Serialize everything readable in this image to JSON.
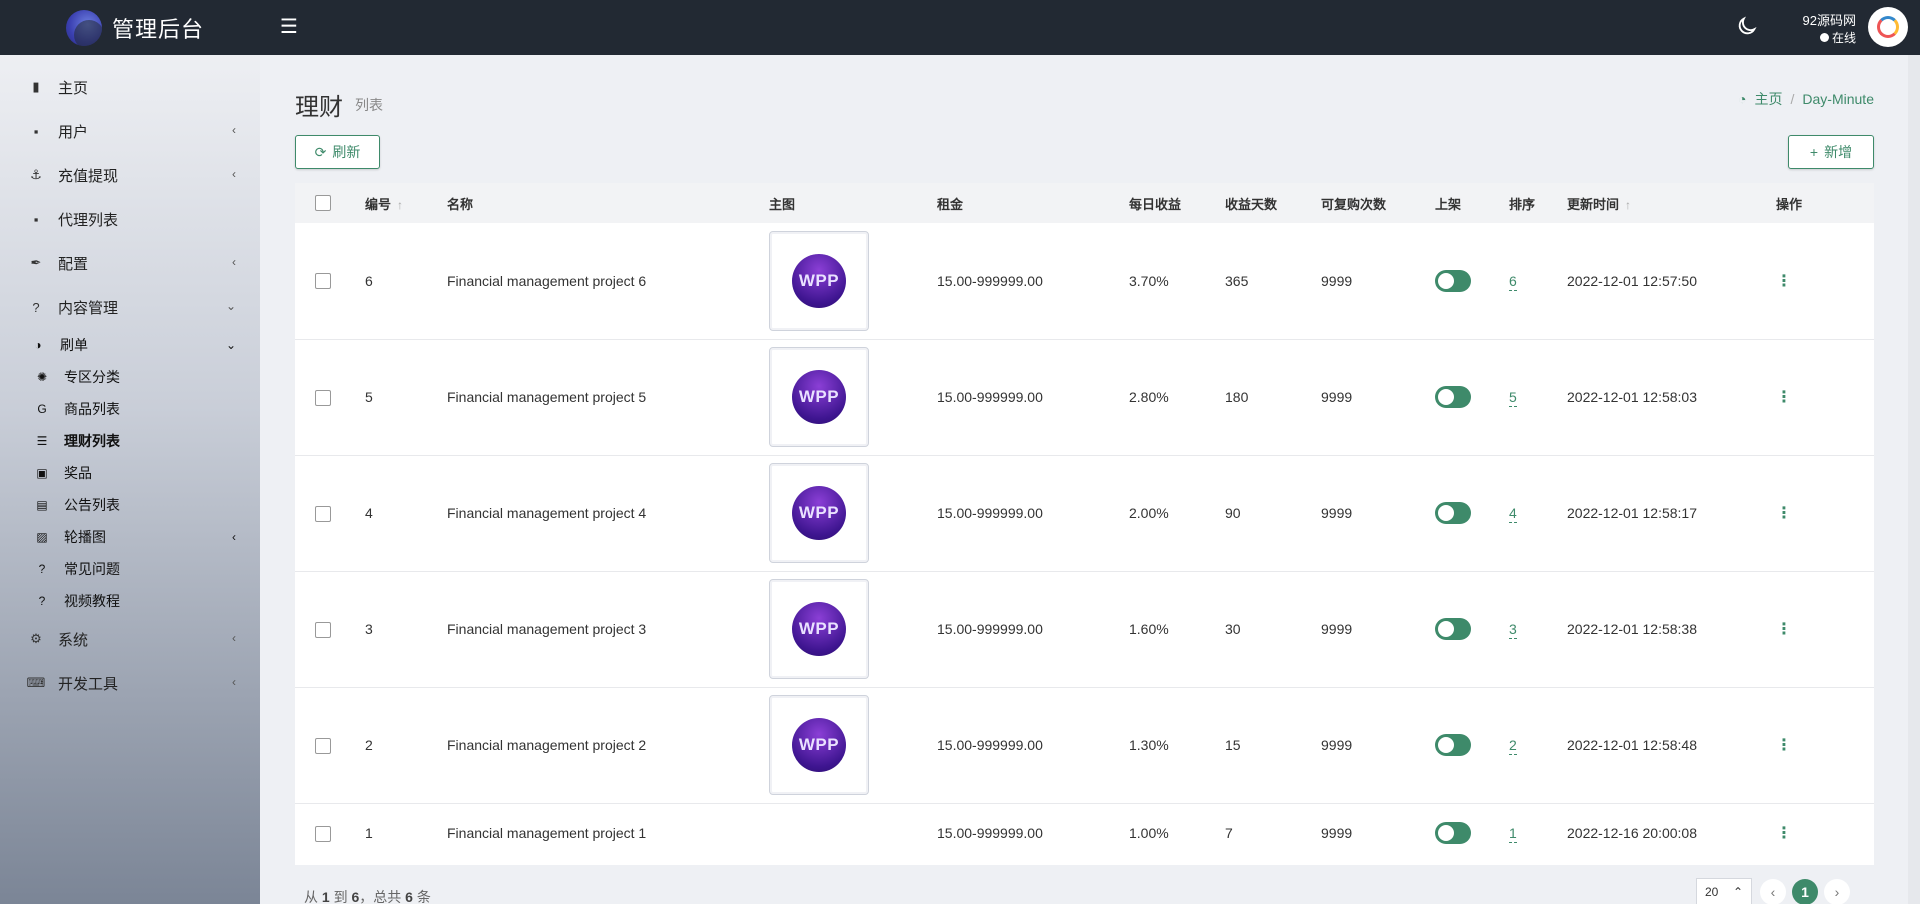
{
  "app": {
    "title": "管理后台"
  },
  "sidebar": {
    "items": [
      {
        "label": "主页",
        "icon": "bar-chart-icon",
        "glyph": "▮",
        "has_chevron": false
      },
      {
        "label": "用户",
        "icon": "user-card-icon",
        "glyph": "▪",
        "has_chevron": true,
        "chevron": "‹"
      },
      {
        "label": "充值提现",
        "icon": "anchor-icon",
        "glyph": "⚓",
        "has_chevron": true,
        "chevron": "‹"
      },
      {
        "label": "代理列表",
        "icon": "user-card-icon",
        "glyph": "▪",
        "has_chevron": false
      },
      {
        "label": "配置",
        "icon": "magic-icon",
        "glyph": "✒",
        "has_chevron": true,
        "chevron": "‹"
      },
      {
        "label": "内容管理",
        "icon": "question-circle-icon",
        "glyph": "?",
        "has_chevron": true,
        "chevron": "⌄"
      }
    ],
    "content_sub": [
      {
        "label": "刷单",
        "icon": "adjust-icon",
        "glyph": "◑",
        "chevron": "⌄"
      },
      {
        "label": "专区分类",
        "icon": "gear-icon",
        "glyph": "✺"
      },
      {
        "label": "商品列表",
        "icon": "google-icon",
        "glyph": "G"
      },
      {
        "label": "理财列表",
        "icon": "list-icon",
        "glyph": "☰"
      },
      {
        "label": "奖品",
        "icon": "money-icon",
        "glyph": "▣"
      },
      {
        "label": "公告列表",
        "icon": "file-icon",
        "glyph": "▤"
      },
      {
        "label": "轮播图",
        "icon": "image-icon",
        "glyph": "▨",
        "chevron": "‹"
      },
      {
        "label": "常见问题",
        "icon": "question-icon",
        "glyph": "?"
      },
      {
        "label": "视频教程",
        "icon": "question-icon",
        "glyph": "?"
      }
    ],
    "bottom_items": [
      {
        "label": "系统",
        "icon": "gear-icon",
        "glyph": "⚙",
        "chevron": "‹"
      },
      {
        "label": "开发工具",
        "icon": "keyboard-icon",
        "glyph": "⌨",
        "chevron": "‹"
      }
    ]
  },
  "topbar": {
    "user_name": "92源码网",
    "user_status": "在线"
  },
  "page": {
    "title": "理财",
    "subtitle": "列表",
    "breadcrumb_home": "主页",
    "breadcrumb_current": "Day-Minute",
    "refresh_label": "刷新",
    "add_label": "新增"
  },
  "table": {
    "headers": {
      "id": "编号",
      "name": "名称",
      "image": "主图",
      "rent": "租金",
      "daily": "每日收益",
      "days": "收益天数",
      "repurchase": "可复购次数",
      "listed": "上架",
      "sort": "排序",
      "updated": "更新时间",
      "ops": "操作"
    },
    "rows": [
      {
        "id": "6",
        "name": "Financial management project 6",
        "image": "WPP",
        "rent": "15.00-999999.00",
        "daily": "3.70%",
        "days": "365",
        "repurchase": "9999",
        "listed": true,
        "sort": "6",
        "updated": "2022-12-01 12:57:50"
      },
      {
        "id": "5",
        "name": "Financial management project 5",
        "image": "WPP",
        "rent": "15.00-999999.00",
        "daily": "2.80%",
        "days": "180",
        "repurchase": "9999",
        "listed": true,
        "sort": "5",
        "updated": "2022-12-01 12:58:03"
      },
      {
        "id": "4",
        "name": "Financial management project 4",
        "image": "WPP",
        "rent": "15.00-999999.00",
        "daily": "2.00%",
        "days": "90",
        "repurchase": "9999",
        "listed": true,
        "sort": "4",
        "updated": "2022-12-01 12:58:17"
      },
      {
        "id": "3",
        "name": "Financial management project 3",
        "image": "WPP",
        "rent": "15.00-999999.00",
        "daily": "1.60%",
        "days": "30",
        "repurchase": "9999",
        "listed": true,
        "sort": "3",
        "updated": "2022-12-01 12:58:38"
      },
      {
        "id": "2",
        "name": "Financial management project 2",
        "image": "WPP",
        "rent": "15.00-999999.00",
        "daily": "1.30%",
        "days": "15",
        "repurchase": "9999",
        "listed": true,
        "sort": "2",
        "updated": "2022-12-01 12:58:48"
      },
      {
        "id": "1",
        "name": "Financial management project 1",
        "image": "",
        "rent": "15.00-999999.00",
        "daily": "1.00%",
        "days": "7",
        "repurchase": "9999",
        "listed": true,
        "sort": "1",
        "updated": "2022-12-16 20:00:08"
      }
    ]
  },
  "footer": {
    "from_label": "从",
    "from": "1",
    "to_label": "到",
    "to": "6",
    "total_label": "，总共",
    "total": "6",
    "unit": "条",
    "page_size": "20",
    "current_page": "1",
    "prev": "‹",
    "next": "›"
  },
  "colors": {
    "accent": "#3e8a6a",
    "topbar": "#222933"
  }
}
